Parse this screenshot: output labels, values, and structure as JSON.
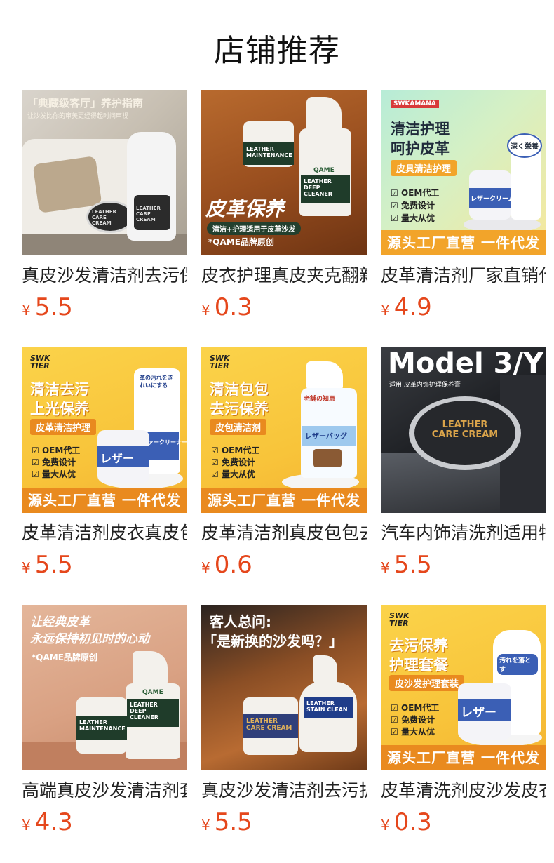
{
  "page": {
    "title": "店铺推荐"
  },
  "currency": "¥",
  "products": [
    {
      "name": "真皮沙发清洁剂去污保养",
      "price": "5.5",
      "image": {
        "headline": "「典藏级客厅」养护指南",
        "subline": "让沙发比你的审美更经得起时间审视",
        "jar_label": "LEATHER CARE CREAM",
        "bottle_label": "LEATHER CARE CREAM"
      }
    },
    {
      "name": "皮衣护理真皮夹克翻新",
      "price": "0.3",
      "image": {
        "jar_label": "LEATHER MAINTENANCE",
        "bottle_brand": "QAME",
        "bottle_label": "LEATHER DEEP CLEANER",
        "headline": "皮革保养",
        "pill": "清洁+护理适用于皮革沙发",
        "brand_note": "*QAME品牌原创"
      }
    },
    {
      "name": "皮革清洁剂厂家直销代发",
      "price": "4.9",
      "image": {
        "logo": "SWKAMANA",
        "headline1": "清洁护理",
        "headline2": "呵护皮革",
        "pill": "皮具清洁护理",
        "checks": [
          "OEM代工",
          "免费设计",
          "量大从优"
        ],
        "product_text": "レザークリーム",
        "bottle_badge": "深く栄養",
        "banner": "源头工厂直营 一件代发"
      }
    },
    {
      "name": "皮革清洁剂皮衣真皮包包",
      "price": "5.5",
      "image": {
        "logo": "SWK TIER",
        "headline1": "清洁去污",
        "headline2": "上光保养",
        "pill": "皮革清洁护理",
        "checks": [
          "OEM代工",
          "免费设计",
          "量大从优"
        ],
        "product_text": "レザー",
        "bottle_text": "ソファークリーナー",
        "bottle_badge": "革の汚れをきれいにする",
        "banner": "源头工厂直营 一件代发"
      }
    },
    {
      "name": "皮革清洁剂真皮包包去污",
      "price": "0.6",
      "image": {
        "logo": "SWK TIER",
        "headline1": "清洁包包",
        "headline2": "去污保养",
        "pill": "皮包清洁剂",
        "checks": [
          "OEM代工",
          "免费设计",
          "量大从优"
        ],
        "bottle_text": "レザーバッグ",
        "bottle_badge": "老舗の知恵",
        "banner": "源头工厂直营 一件代发"
      }
    },
    {
      "name": "汽车内饰清洗剂适用特斯拉",
      "price": "5.5",
      "image": {
        "headline": "Model 3/Y",
        "subline": "适用 皮革内饰护理保养膏",
        "jar_label": "LEATHER CARE CREAM"
      }
    },
    {
      "name": "高端真皮沙发清洁剂套装",
      "price": "4.3",
      "image": {
        "headline1": "让经典皮革",
        "headline2": "永远保持初见时的心动",
        "brand_note": "*QAME品牌原创",
        "jar_label": "LEATHER MAINTENANCE",
        "bottle_brand": "QAME",
        "bottle_label": "LEATHER DEEP CLEANER"
      }
    },
    {
      "name": "真皮沙发清洁剂去污护理",
      "price": "5.5",
      "image": {
        "headline1": "客人总问:",
        "headline2": "「是新换的沙发吗？」",
        "jar_label": "LEATHER CARE CREAM",
        "bottle_label": "LEATHER STAIN CLEAN"
      }
    },
    {
      "name": "皮革清洗剂皮沙发皮衣",
      "price": "0.3",
      "image": {
        "logo": "SWK TIER",
        "headline1": "去污保养",
        "headline2": "护理套餐",
        "pill": "皮沙发护理套装",
        "checks": [
          "OEM代工",
          "免费设计",
          "量大从优"
        ],
        "product_text": "レザー",
        "bottle_badge": "汚れを落とす",
        "banner": "源头工厂直营 一件代发"
      }
    }
  ]
}
